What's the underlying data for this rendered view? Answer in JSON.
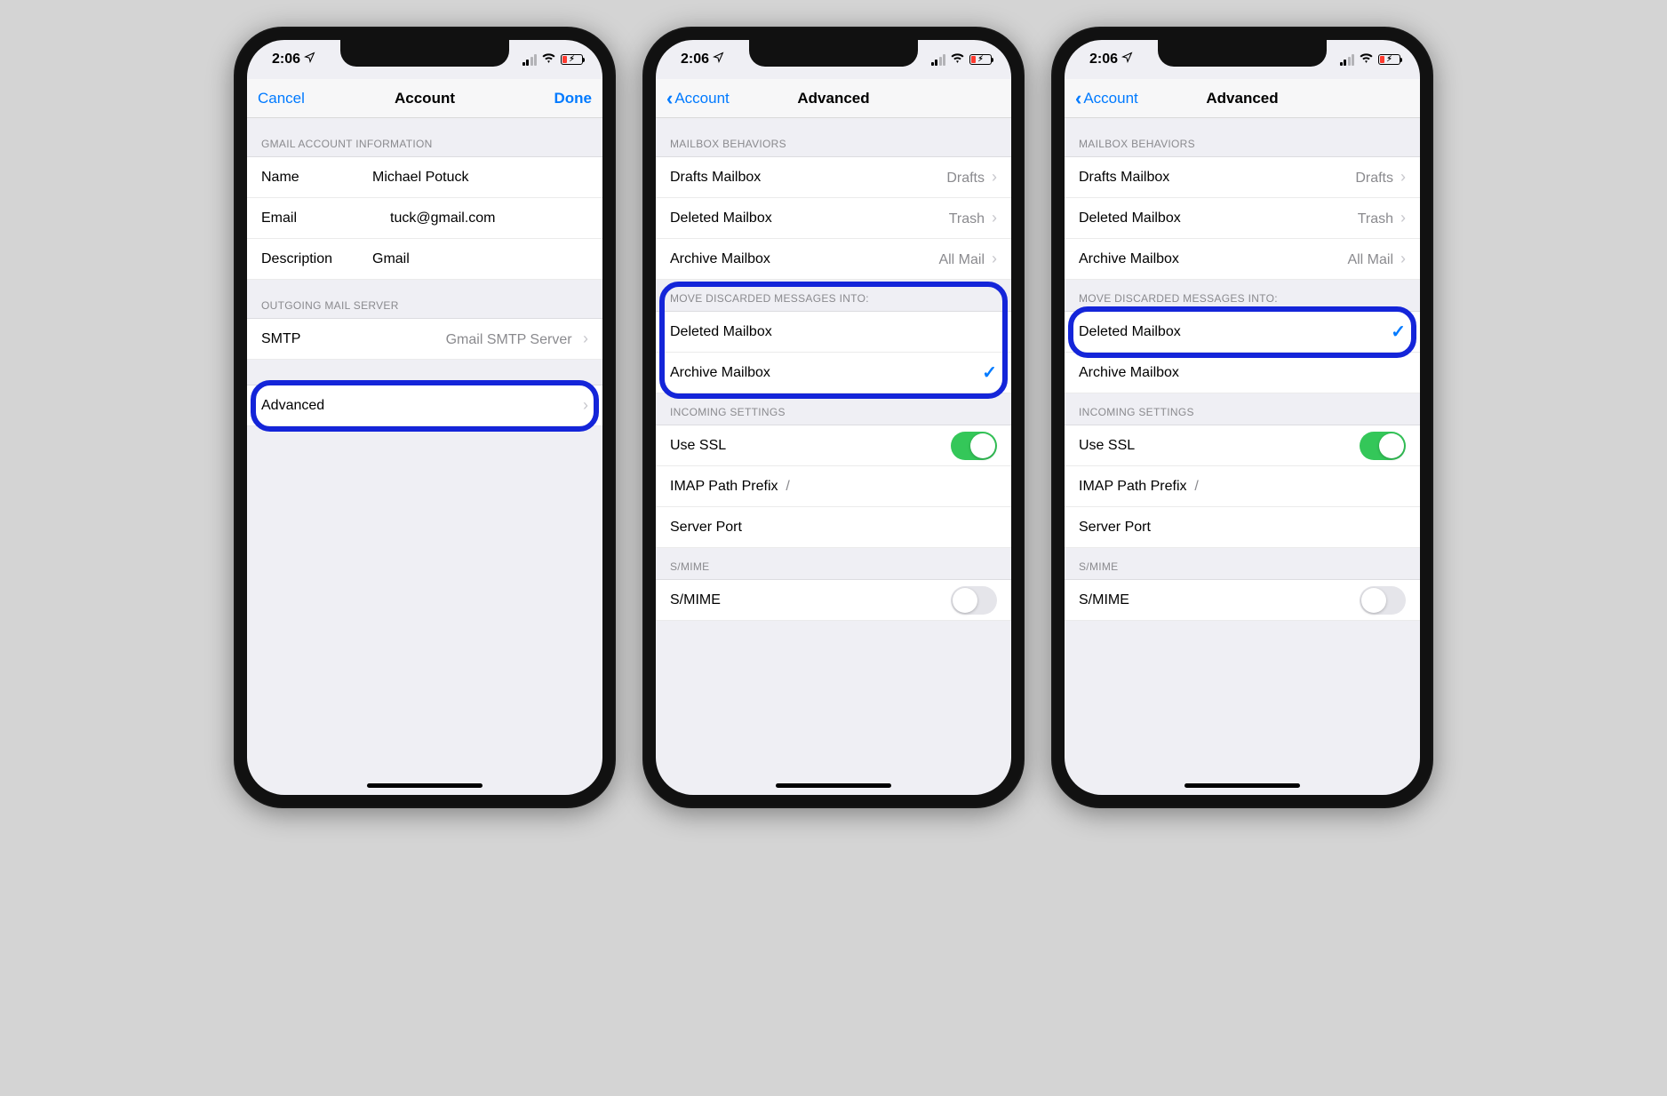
{
  "status": {
    "time": "2:06"
  },
  "phone1": {
    "nav": {
      "left": "Cancel",
      "title": "Account",
      "right": "Done"
    },
    "section1_header": "GMAIL ACCOUNT INFORMATION",
    "rows": {
      "name_key": "Name",
      "name_val": "Michael Potuck",
      "email_key": "Email",
      "email_val": "tuck@gmail.com",
      "desc_key": "Description",
      "desc_val": "Gmail"
    },
    "section2_header": "OUTGOING MAIL SERVER",
    "smtp_key": "SMTP",
    "smtp_val": "Gmail SMTP Server",
    "advanced": "Advanced"
  },
  "phone2": {
    "nav": {
      "back": "Account",
      "title": "Advanced"
    },
    "sec_mb": "MAILBOX BEHAVIORS",
    "drafts_k": "Drafts Mailbox",
    "drafts_v": "Drafts",
    "deleted_k": "Deleted Mailbox",
    "deleted_v": "Trash",
    "archive_k": "Archive Mailbox",
    "archive_v": "All Mail",
    "sec_move": "MOVE DISCARDED MESSAGES INTO:",
    "opt_del": "Deleted Mailbox",
    "opt_arc": "Archive Mailbox",
    "selected": "archive",
    "sec_inc": "INCOMING SETTINGS",
    "ssl_k": "Use SSL",
    "ssl_on": true,
    "imap_k": "IMAP Path Prefix",
    "imap_v": "/",
    "port_k": "Server Port",
    "sec_smime": "S/MIME",
    "smime_k": "S/MIME",
    "smime_on": false
  },
  "phone3": {
    "nav": {
      "back": "Account",
      "title": "Advanced"
    },
    "sec_mb": "MAILBOX BEHAVIORS",
    "drafts_k": "Drafts Mailbox",
    "drafts_v": "Drafts",
    "deleted_k": "Deleted Mailbox",
    "deleted_v": "Trash",
    "archive_k": "Archive Mailbox",
    "archive_v": "All Mail",
    "sec_move": "MOVE DISCARDED MESSAGES INTO:",
    "opt_del": "Deleted Mailbox",
    "opt_arc": "Archive Mailbox",
    "selected": "deleted",
    "sec_inc": "INCOMING SETTINGS",
    "ssl_k": "Use SSL",
    "ssl_on": true,
    "imap_k": "IMAP Path Prefix",
    "imap_v": "/",
    "port_k": "Server Port",
    "sec_smime": "S/MIME",
    "smime_k": "S/MIME",
    "smime_on": false
  }
}
